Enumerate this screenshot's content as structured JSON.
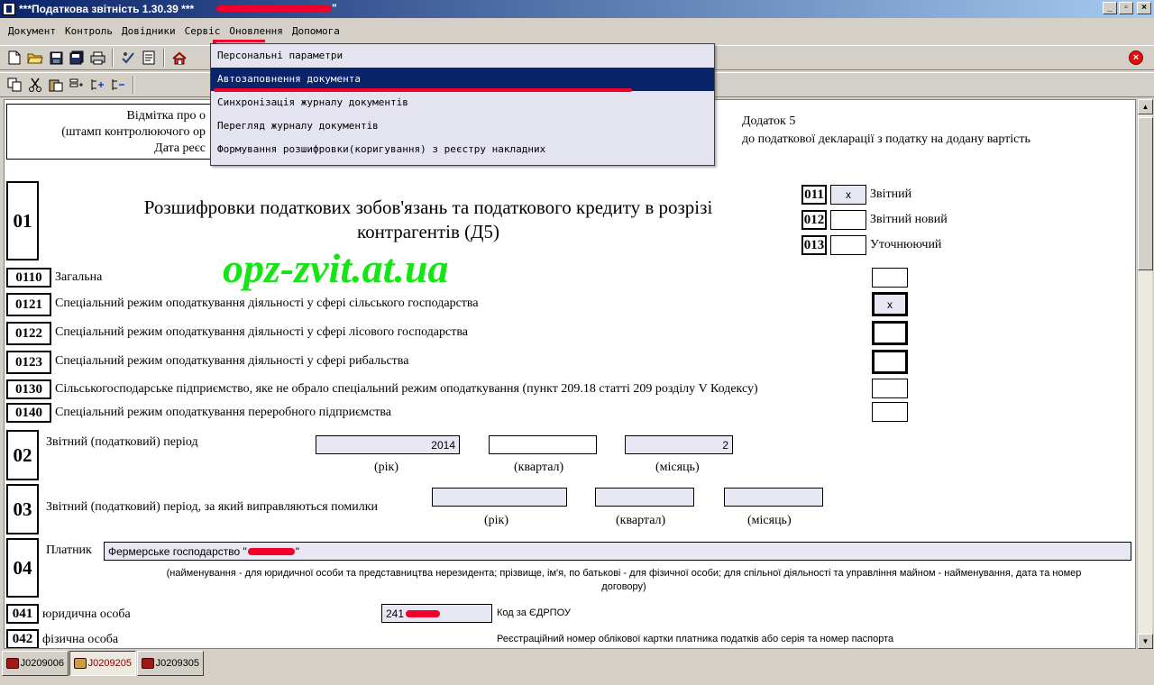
{
  "window": {
    "title": "***Податкова звітність 1.30.39 ***",
    "title_suffix": "\"",
    "buttons": [
      "_",
      "▫",
      "×"
    ]
  },
  "menu": {
    "items": [
      "Документ",
      "Контроль",
      "Довідники",
      "Сервіс",
      "Оновлення",
      "Допомога"
    ]
  },
  "service_menu": {
    "items": [
      "Персональні параметри",
      "Автозаповнення документа",
      "Синхронізація журналу документів",
      "Перегляд журналу документів",
      "Формування розшифровки(коригування) з реєстру накладних"
    ],
    "highlighted_index": 1
  },
  "doc": {
    "stamp": {
      "line1": "Відмітка про о",
      "line2": "(штамп контролюючого ор",
      "line3": "Дата реєс"
    },
    "addendum": {
      "line1": "Додаток 5",
      "line2": "до податкової декларації з податку на додану вартість"
    },
    "section_01": {
      "code": "01",
      "title_line1": "Розшифровки податкових зобов'язань та податкового кредиту в розрізі",
      "title_line2": "контрагентів (Д5)"
    },
    "report_types": [
      {
        "code": "011",
        "label": "Звітний",
        "value": "x"
      },
      {
        "code": "012",
        "label": "Звітний новий",
        "value": ""
      },
      {
        "code": "013",
        "label": "Уточнюючий",
        "value": ""
      }
    ],
    "watermark": "opz-zvit.at.ua",
    "regimes": [
      {
        "code": "0110",
        "label": "Загальна",
        "value": ""
      },
      {
        "code": "0121",
        "label": "Спеціальний режим оподаткування діяльності у сфері сільського господарства",
        "value": "x"
      },
      {
        "code": "0122",
        "label": "Спеціальний режим оподаткування діяльності у сфері лісового господарства",
        "value": ""
      },
      {
        "code": "0123",
        "label": "Спеціальний режим оподаткування діяльності у сфері рибальства",
        "value": ""
      },
      {
        "code": "0130",
        "label": "Сільськогосподарське підприємство, яке не обрало спеціальний режим оподаткування (пункт 209.18 статті 209 розділу V Кодексу)",
        "value": ""
      },
      {
        "code": "0140",
        "label": "Спеціальний режим оподаткування переробного підприємства",
        "value": ""
      }
    ],
    "section_02": {
      "code": "02",
      "label": "Звітний (податковий) період",
      "year": "2014",
      "quarter": "",
      "month": "2",
      "year_caption": "(рік)",
      "quarter_caption": "(квартал)",
      "month_caption": "(місяць)"
    },
    "section_03": {
      "code": "03",
      "label": "Звітний (податковий) період, за який виправляються помилки",
      "year": "",
      "quarter": "",
      "month": "",
      "year_caption": "(рік)",
      "quarter_caption": "(квартал)",
      "month_caption": "(місяць)"
    },
    "section_04": {
      "code": "04",
      "label": "Платник",
      "value": "Фермерське господарство \"",
      "value_end": "\"",
      "caption_line1": "(найменування - для юридичної особи та представництва нерезидента; прізвище, ім'я, по батькові - для фізичної особи; для спільної діяльності та управління майном - найменування, дата та номер",
      "caption_line2": "договору)"
    },
    "section_041": {
      "code": "041",
      "label": "юридична особа",
      "value": "241",
      "code_label": "Код за ЄДРПОУ"
    },
    "section_042": {
      "code": "042",
      "label": "фізична особа",
      "caption": "Реєстраційний номер облікової картки платника податків або серія та номер паспорта"
    }
  },
  "tabs": [
    {
      "label": "J0209006",
      "active": false
    },
    {
      "label": "J0209205",
      "active": true
    },
    {
      "label": "J0209305",
      "active": false
    }
  ]
}
